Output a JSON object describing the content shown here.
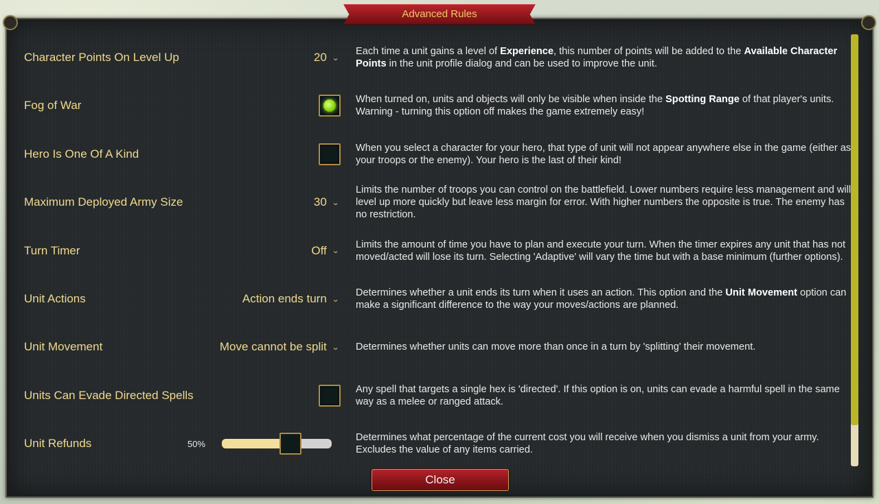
{
  "dialog": {
    "title": "Advanced Rules",
    "close_label": "Close"
  },
  "rows": [
    {
      "label": "Character Points On Level Up",
      "control": "dropdown",
      "value": "20",
      "desc": [
        {
          "t": "Each time a unit gains a level of "
        },
        {
          "b": "Experience"
        },
        {
          "t": ", this number of points will be added to the "
        },
        {
          "b": "Available Character Points"
        },
        {
          "t": " in the unit profile dialog and can be used to improve the unit."
        }
      ]
    },
    {
      "label": "Fog of War",
      "control": "checkbox",
      "checked": true,
      "desc": [
        {
          "t": "When turned on, units and objects will only be visible when inside the "
        },
        {
          "b": "Spotting Range"
        },
        {
          "t": " of that player's units. Warning - turning this option off makes the game extremely easy!"
        }
      ]
    },
    {
      "label": "Hero Is One Of A Kind",
      "control": "checkbox",
      "checked": false,
      "desc": [
        {
          "t": "When you select a character for your hero, that type of unit will not appear anywhere else in the game (either as your troops or the enemy). Your hero is the last of their kind!"
        }
      ]
    },
    {
      "label": "Maximum Deployed Army Size",
      "control": "dropdown",
      "value": "30",
      "desc": [
        {
          "t": "Limits the number of troops you can control on the battlefield. Lower numbers require less management and will level up more quickly but leave less margin for error. With higher numbers the opposite is true. The enemy has no restriction."
        }
      ]
    },
    {
      "label": "Turn Timer",
      "control": "dropdown",
      "value": "Off",
      "desc": [
        {
          "t": "Limits the amount of time you have to plan and execute your turn. When the timer expires any unit that has not moved/acted will lose its turn. Selecting 'Adaptive' will vary the time but with a base minimum (further options)."
        }
      ]
    },
    {
      "label": "Unit Actions",
      "control": "dropdown",
      "value": "Action ends turn",
      "desc": [
        {
          "t": "Determines whether a unit ends its turn when it uses an action. This option and the "
        },
        {
          "b": "Unit Movement"
        },
        {
          "t": " option can make a significant difference to the way your moves/actions are planned."
        }
      ]
    },
    {
      "label": "Unit Movement",
      "control": "dropdown",
      "value": "Move cannot be split",
      "desc": [
        {
          "t": "Determines whether units can move more than once in a turn by 'splitting' their movement."
        }
      ]
    },
    {
      "label": "Units Can Evade Directed Spells",
      "control": "checkbox",
      "checked": false,
      "desc": [
        {
          "t": "Any spell that targets a single hex is 'directed'. If this option is on, units can evade a harmful spell in the same way as a melee or ranged attack."
        }
      ]
    },
    {
      "label": "Unit Refunds",
      "control": "slider",
      "value_text": "50%",
      "level": 0.5,
      "desc": [
        {
          "t": "Determines what percentage of the current cost you will receive when you dismiss a unit from your army. Excludes the value of any items carried."
        }
      ]
    }
  ],
  "scrollbar": {
    "position": 0,
    "visible_fraction": 0.9
  },
  "colors": {
    "label": "#efd98f",
    "panel": "#262a2c",
    "banner": "#a61d23",
    "check_on": "#9be21f",
    "scroll_thumb": "#bbb52a"
  },
  "icons": {
    "dropdown": "chevron-down-icon",
    "checked": "green-orb-icon"
  }
}
